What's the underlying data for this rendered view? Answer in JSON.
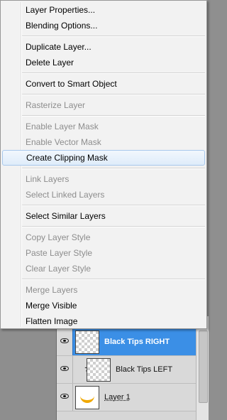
{
  "context_menu": {
    "items": [
      {
        "label": "Layer Properties...",
        "enabled": true
      },
      {
        "label": "Blending Options...",
        "enabled": true
      },
      {
        "label": "Duplicate Layer...",
        "enabled": true
      },
      {
        "label": "Delete Layer",
        "enabled": true
      },
      {
        "label": "Convert to Smart Object",
        "enabled": true
      },
      {
        "label": "Rasterize Layer",
        "enabled": false
      },
      {
        "label": "Enable Layer Mask",
        "enabled": false
      },
      {
        "label": "Enable Vector Mask",
        "enabled": false
      },
      {
        "label": "Create Clipping Mask",
        "enabled": true,
        "highlighted": true
      },
      {
        "label": "Link Layers",
        "enabled": false
      },
      {
        "label": "Select Linked Layers",
        "enabled": false
      },
      {
        "label": "Select Similar Layers",
        "enabled": true
      },
      {
        "label": "Copy Layer Style",
        "enabled": false
      },
      {
        "label": "Paste Layer Style",
        "enabled": false
      },
      {
        "label": "Clear Layer Style",
        "enabled": false
      },
      {
        "label": "Merge Layers",
        "enabled": false
      },
      {
        "label": "Merge Visible",
        "enabled": true
      },
      {
        "label": "Flatten Image",
        "enabled": true
      }
    ]
  },
  "layers_panel": {
    "layers": [
      {
        "name": "Black Tips RIGHT",
        "selected": true,
        "visible": true,
        "clipped": false,
        "icon": "transparent-thumbnail"
      },
      {
        "name": "Black Tips LEFT",
        "selected": false,
        "visible": true,
        "clipped": true,
        "icon": "transparent-thumbnail"
      },
      {
        "name": "Layer 1",
        "selected": false,
        "visible": true,
        "clipped": false,
        "icon": "banana-thumbnail"
      }
    ]
  },
  "colors": {
    "selected_layer": "#3b8fe6",
    "menu_highlight_border": "#a8c8ec",
    "disabled_text": "#8d8d8d"
  }
}
